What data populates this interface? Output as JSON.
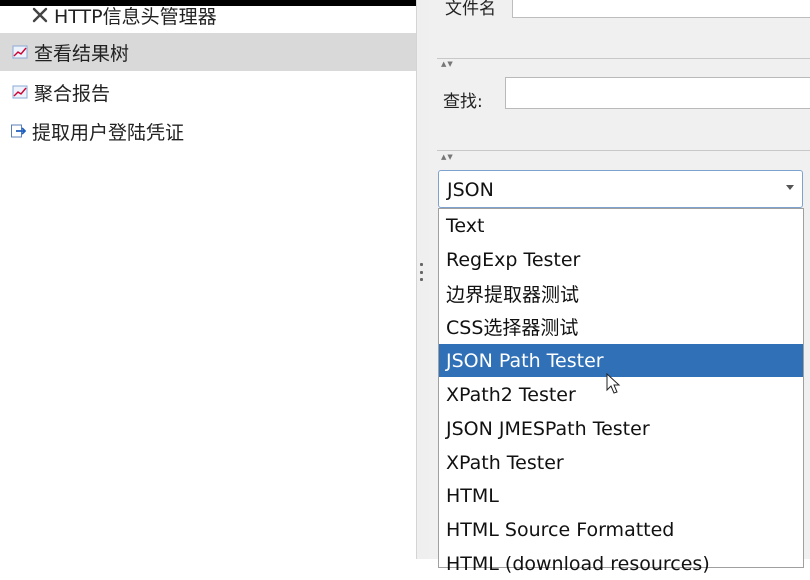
{
  "tree": {
    "items": [
      {
        "label": "HTTP信息头管理器",
        "icon": "wrench-icon",
        "selected": false
      },
      {
        "label": "查看结果树",
        "icon": "chart-icon",
        "selected": true
      },
      {
        "label": "聚合报告",
        "icon": "chart-icon",
        "selected": false
      },
      {
        "label": "提取用户登陆凭证",
        "icon": "extractor-icon",
        "selected": false
      }
    ]
  },
  "right": {
    "top_label": "文件名",
    "find_label": "查找:",
    "find_value": "",
    "renderer_select": {
      "selected": "JSON",
      "options": [
        "Text",
        "RegExp Tester",
        "边界提取器测试",
        "CSS选择器测试",
        "JSON Path Tester",
        "XPath2 Tester",
        "JSON JMESPath Tester",
        "XPath Tester",
        "HTML",
        "HTML Source Formatted",
        "HTML (download resources)"
      ],
      "highlighted": "JSON Path Tester"
    }
  },
  "colors": {
    "highlight": "#3070b7",
    "selected_row": "#d9d9d9"
  }
}
